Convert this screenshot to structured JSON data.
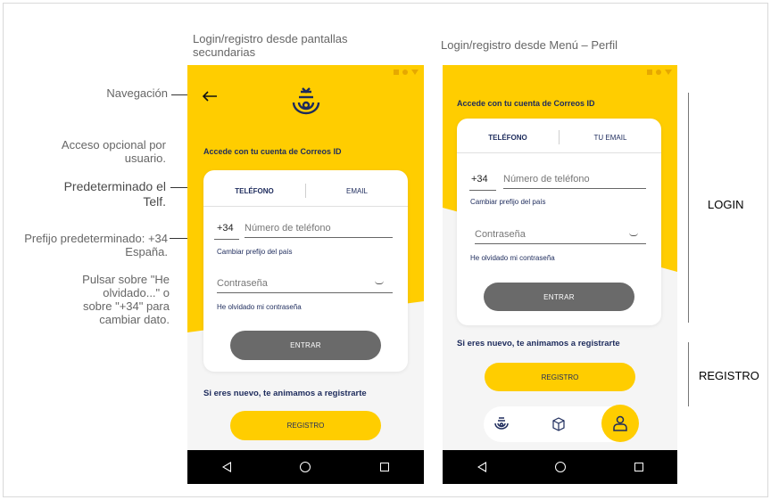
{
  "captions": {
    "left": "Login/registro desde pantallas secundarias",
    "right": "Login/registro desde Menú – Perfil"
  },
  "notes": {
    "nav": "Navegación",
    "optional": "Acceso opcional por usuario.",
    "default_tel": "Predeterminado el Telf.",
    "prefix": "Prefijo predeterminado: +34 España.",
    "press": "Pulsar sobre \"He olvidado...\" o sobre \"+34\" para cambiar dato."
  },
  "phone_left": {
    "heading": "Accede con tu cuenta de Correos ID",
    "tab_phone": "TELÉFONO",
    "tab_email": "EMAIL",
    "prefix": "+34",
    "phone_placeholder": "Número de teléfono",
    "change_prefix": "Cambiar prefijo del país",
    "password_placeholder": "Contraseña",
    "forgot": "He olvidado mi contraseña",
    "enter": "ENTRAR",
    "new_user": "Si eres nuevo, te animamos a registrarte",
    "register": "REGISTRO"
  },
  "phone_right": {
    "heading": "Accede con tu cuenta de Correos ID",
    "tab_phone": "TELÉFONO",
    "tab_email": "TU EMAIL",
    "prefix": "+34",
    "phone_placeholder": "Número de teléfono",
    "change_prefix": "Cambiar prefijo del país",
    "password_placeholder": "Contraseña",
    "forgot": "He olvidado mi contraseña",
    "enter": "ENTRAR",
    "new_user": "Si eres nuevo, te animamos a registrarte",
    "register": "REGISTRO"
  },
  "side_labels": {
    "login": "LOGIN",
    "registro": "REGISTRO"
  },
  "colors": {
    "brand_yellow": "#ffcd00",
    "brand_navy": "#1d2b5c",
    "button_grey": "#6a6a6a"
  },
  "icons": [
    "back-arrow-icon",
    "correos-logo-icon",
    "eye-hidden-icon",
    "package-icon",
    "user-icon",
    "nav-back-icon",
    "nav-home-icon",
    "nav-recents-icon"
  ]
}
